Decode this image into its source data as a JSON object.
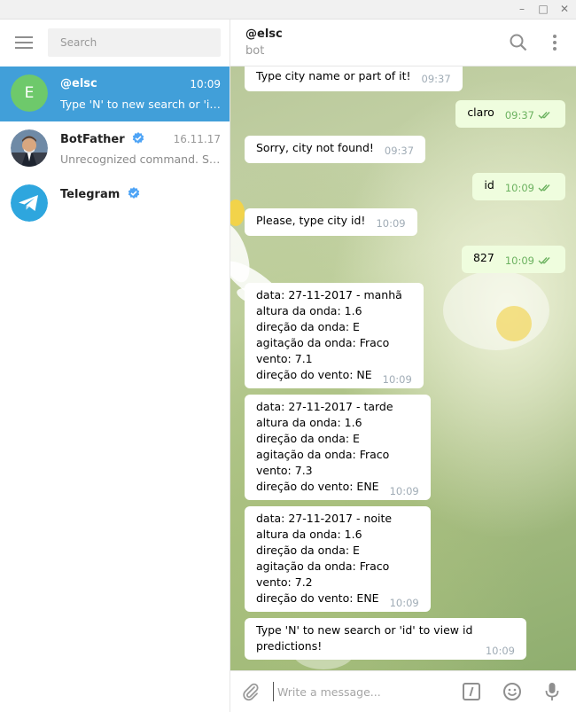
{
  "window": {
    "minimize_glyph": "–",
    "maximize_glyph": "□",
    "close_glyph": "✕"
  },
  "sidebar": {
    "search_placeholder": "Search",
    "dialogs": [
      {
        "name": "@elsc",
        "avatar_letter": "E",
        "time": "10:09",
        "preview": "Type 'N' to new search or 'id' to view id predictions!",
        "active": true,
        "verified": false
      },
      {
        "name": "BotFather",
        "time": "16.11.17",
        "preview": "Unrecognized command. Say what?",
        "active": false,
        "verified": true
      },
      {
        "name": "Telegram",
        "time": "",
        "preview": "",
        "active": false,
        "verified": true
      }
    ]
  },
  "chat": {
    "peer_name": "@elsc",
    "peer_status": "bot",
    "messages": [
      {
        "dir": "in",
        "text": "Type city name or part of it!",
        "time": "09:37"
      },
      {
        "dir": "out",
        "text": "claro",
        "time": "09:37"
      },
      {
        "dir": "in",
        "text": "Sorry, city not found!",
        "time": "09:37"
      },
      {
        "dir": "out",
        "text": "id",
        "time": "10:09"
      },
      {
        "dir": "in",
        "text": "Please, type city id!",
        "time": "10:09"
      },
      {
        "dir": "out",
        "text": "827",
        "time": "10:09"
      },
      {
        "dir": "in",
        "text": "data: 27-11-2017 - manhã\naltura da onda: 1.6\ndireção da onda: E\nagitação da onda: Fraco\nvento: 7.1\ndireção do vento: NE",
        "time": "10:09"
      },
      {
        "dir": "in",
        "text": "data: 27-11-2017 - tarde\naltura da onda: 1.6\ndireção da onda: E\nagitação da onda: Fraco\nvento: 7.3\ndireção do vento: ENE",
        "time": "10:09"
      },
      {
        "dir": "in",
        "text": "data: 27-11-2017 - noite\naltura da onda: 1.6\ndireção da onda: E\nagitação da onda: Fraco\nvento: 7.2\ndireção do vento: ENE",
        "time": "10:09"
      },
      {
        "dir": "in",
        "text": "Type 'N' to new search or 'id' to view id\npredictions!",
        "time": "10:09"
      }
    ],
    "input_placeholder": "Write a message..."
  },
  "colors": {
    "accent": "#419fd9",
    "avatar_green": "#6ec96b",
    "outgoing_bubble": "#effdde",
    "read_ticks": "#6cb260"
  },
  "icons": {
    "menu": "hamburger-menu-icon",
    "search": "search-icon",
    "more": "more-vertical-icon",
    "attach": "paperclip-icon",
    "commands": "slash-command-icon",
    "emoji": "emoji-icon",
    "voice": "microphone-icon",
    "verified": "verified-badge-icon"
  }
}
